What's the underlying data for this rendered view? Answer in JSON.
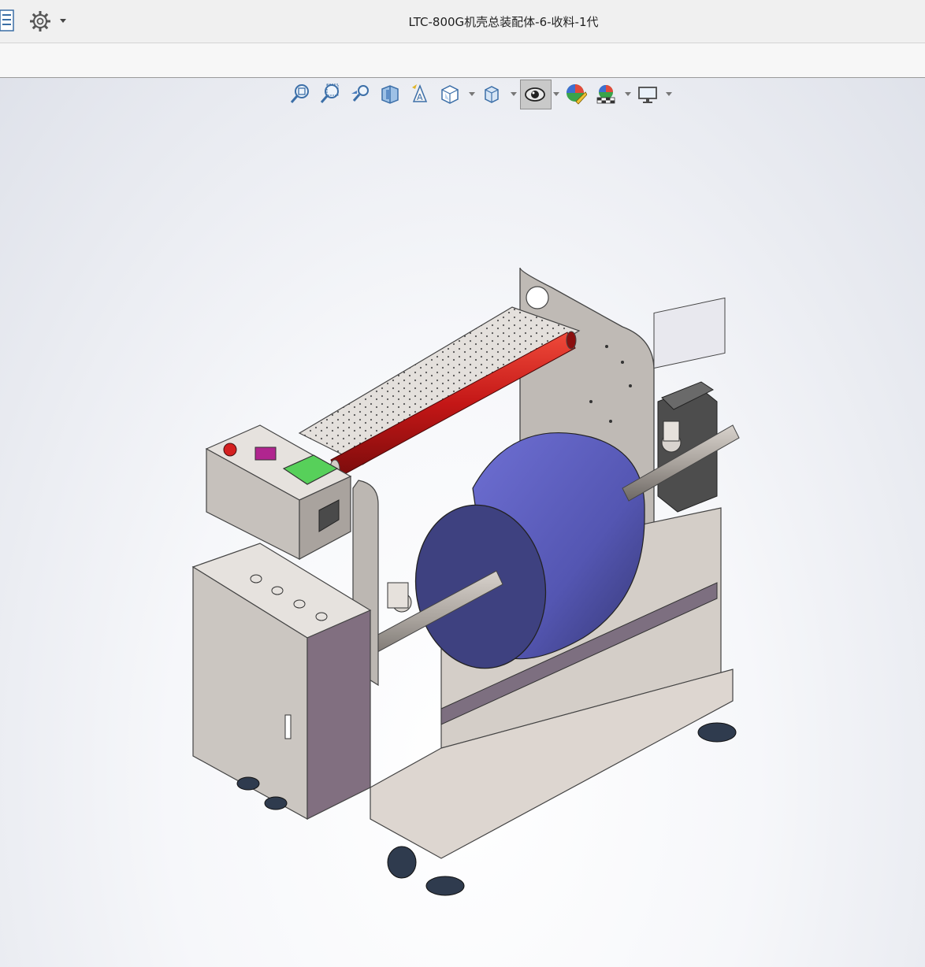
{
  "window": {
    "title": "LTC-800G机壳总装配体-6-收料-1代"
  },
  "titlebar": {
    "icons": [
      "feature-manager-icon",
      "gear-icon",
      "dropdown-arrow-icon"
    ]
  },
  "heads_up_toolbar": {
    "tools": [
      {
        "name": "zoom-to-fit-icon"
      },
      {
        "name": "zoom-to-area-icon"
      },
      {
        "name": "previous-view-icon"
      },
      {
        "name": "section-view-icon"
      },
      {
        "name": "dynamic-annotation-icon"
      },
      {
        "name": "view-orientation-icon",
        "has_dropdown": true
      },
      {
        "name": "display-style-icon",
        "has_dropdown": true
      },
      {
        "name": "hide-show-items-icon",
        "has_dropdown": true,
        "active": true
      },
      {
        "name": "edit-appearance-icon"
      },
      {
        "name": "apply-scene-icon",
        "has_dropdown": true
      },
      {
        "name": "view-settings-icon",
        "has_dropdown": true
      }
    ]
  },
  "model": {
    "description_icon": "rewinding-machine-3d-model",
    "colors": {
      "frame": "#b7b2ad",
      "roll": "#4a4fa3",
      "red_roller": "#c21818",
      "screen": "#57d05a",
      "estop": "#d42020"
    }
  }
}
